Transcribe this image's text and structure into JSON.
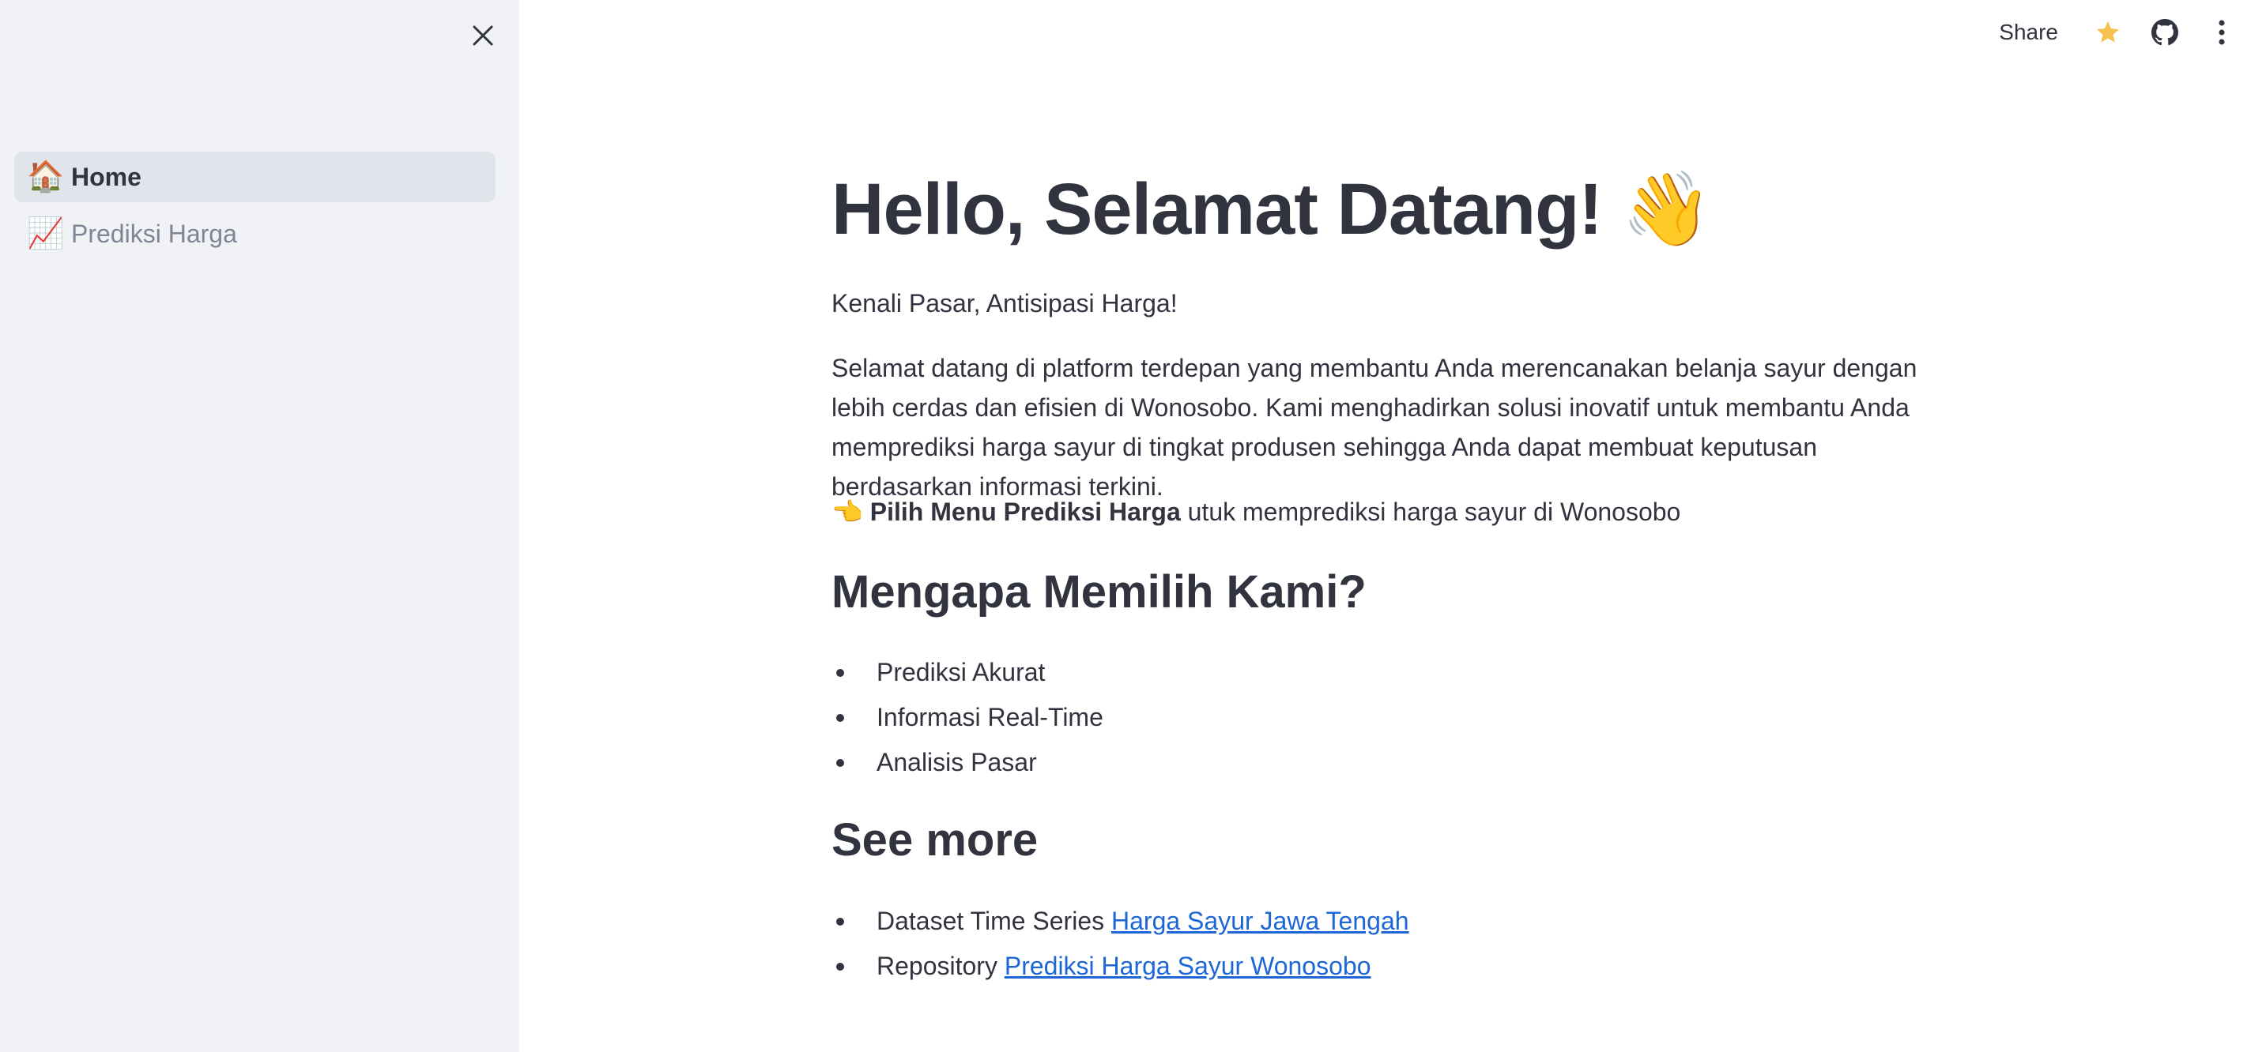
{
  "sidebar": {
    "close_label": "Close sidebar",
    "items": [
      {
        "emoji": "🏠",
        "label": "Home",
        "active": true
      },
      {
        "emoji": "📈",
        "label": "Prediksi Harga",
        "active": false
      }
    ]
  },
  "toolbar": {
    "share_label": "Share",
    "icons": [
      "star-icon",
      "github-icon",
      "more-vertical-icon"
    ],
    "star_color": "#f5c14f"
  },
  "main": {
    "title": "Hello, Selamat Datang! 👋",
    "tagline": "Kenali Pasar, Antisipasi Harga!",
    "intro": "Selamat datang di platform terdepan yang membantu Anda merencanakan belanja sayur dengan lebih cerdas dan efisien di Wonosobo. Kami menghadirkan solusi inovatif untuk membantu Anda memprediksi harga sayur di tingkat produsen sehingga Anda dapat membuat keputusan berdasarkan informasi terkini.",
    "cta": {
      "emoji": "👈",
      "bold": "Pilih Menu Prediksi Harga",
      "rest": " utuk memprediksi harga sayur di Wonosobo"
    },
    "why_heading": "Mengapa Memilih Kami?",
    "why_items": [
      "Prediksi Akurat",
      "Informasi Real-Time",
      "Analisis Pasar"
    ],
    "see_heading": "See more",
    "see_items": [
      {
        "prefix": "Dataset Time Series ",
        "link": "Harga Sayur Jawa Tengah"
      },
      {
        "prefix": "Repository ",
        "link": "Prediksi Harga Sayur Wonosobo"
      }
    ]
  },
  "colors": {
    "sidebar_bg": "#f0f2f6",
    "active_item_bg": "#e0e5ec",
    "text": "#31333f",
    "muted_text": "#808495",
    "link": "#1c66d6"
  }
}
